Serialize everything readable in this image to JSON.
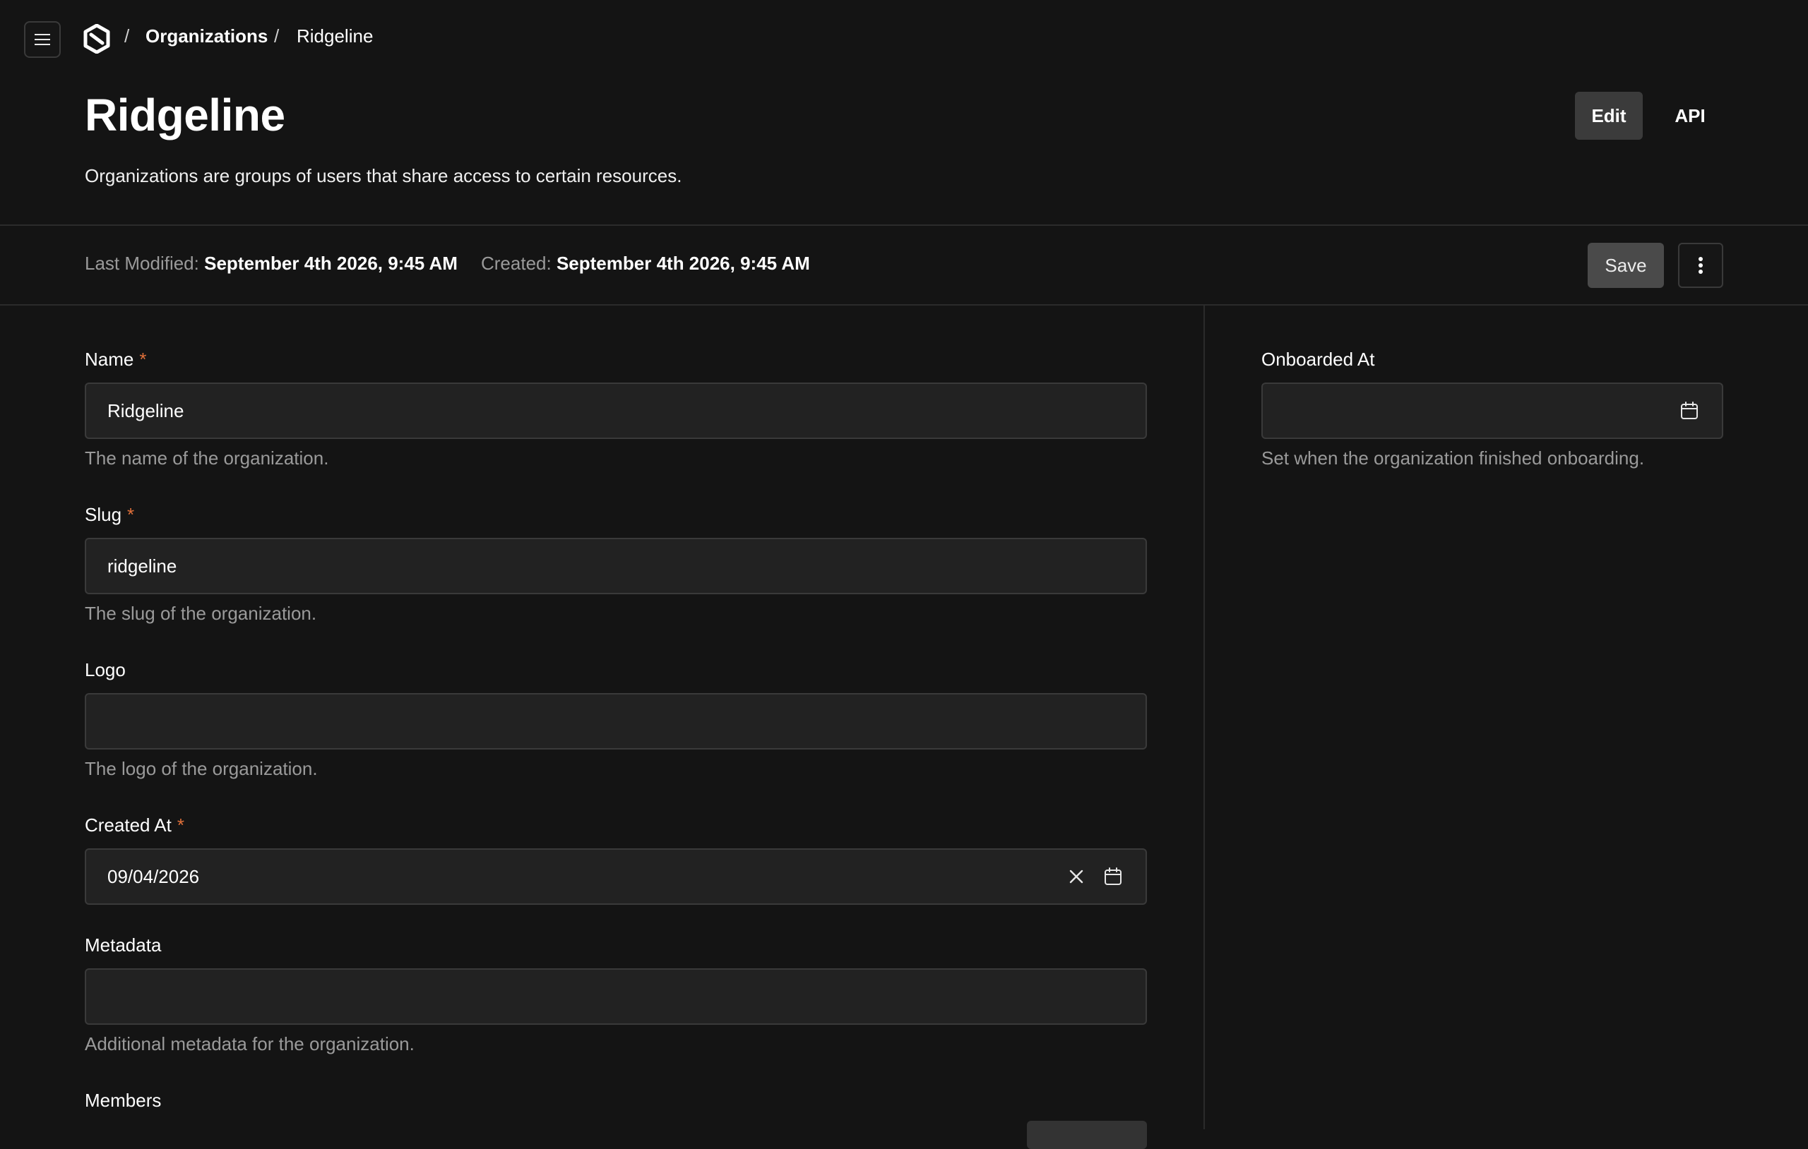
{
  "breadcrumb": {
    "separator": "/",
    "items": [
      "Organizations",
      "Ridgeline"
    ]
  },
  "header": {
    "title": "Ridgeline",
    "description": "Organizations are groups of users that share access to certain resources.",
    "edit_label": "Edit",
    "api_label": "API"
  },
  "meta": {
    "last_modified_label": "Last Modified:",
    "last_modified_value": "September 4th 2026, 9:45 AM",
    "created_label": "Created:",
    "created_value": "September 4th 2026, 9:45 AM",
    "save_label": "Save"
  },
  "form": {
    "required_mark": "*",
    "name": {
      "label": "Name",
      "value": "Ridgeline",
      "help": "The name of the organization."
    },
    "slug": {
      "label": "Slug",
      "value": "ridgeline",
      "help": "The slug of the organization."
    },
    "logo": {
      "label": "Logo",
      "value": "",
      "help": "The logo of the organization."
    },
    "created_at": {
      "label": "Created At",
      "value": "09/04/2026"
    },
    "metadata": {
      "label": "Metadata",
      "value": "",
      "help": "Additional metadata for the organization."
    },
    "members": {
      "label": "Members"
    },
    "onboarded_at": {
      "label": "Onboarded At",
      "value": "",
      "help": "Set when the organization finished onboarding."
    }
  },
  "icons": {
    "menu": "hamburger-icon",
    "logo": "app-logo",
    "more": "vertical-dots-icon",
    "calendar": "calendar-icon",
    "clear": "close-icon"
  },
  "colors": {
    "background": "#141414",
    "field_background": "#222222",
    "border": "#3a3a3a",
    "required": "#e0703a",
    "muted_text": "#9a9a9a"
  }
}
